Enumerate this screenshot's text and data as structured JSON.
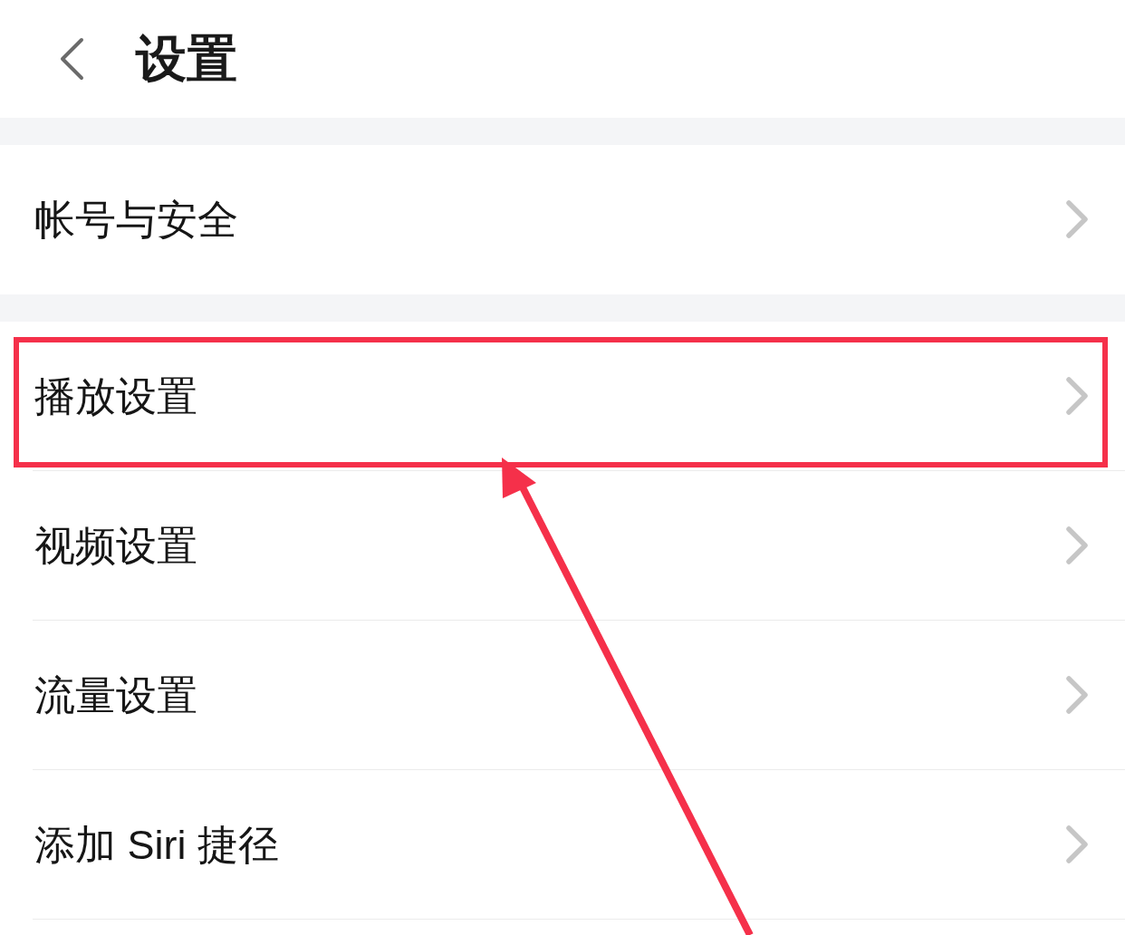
{
  "header": {
    "title": "设置"
  },
  "sections": [
    {
      "items": [
        {
          "label": "帐号与安全",
          "highlighted": false
        }
      ]
    },
    {
      "items": [
        {
          "label": "播放设置",
          "highlighted": true
        },
        {
          "label": "视频设置",
          "highlighted": false
        },
        {
          "label": "流量设置",
          "highlighted": false
        },
        {
          "label": "添加 Siri 捷径",
          "highlighted": false
        }
      ]
    }
  ]
}
